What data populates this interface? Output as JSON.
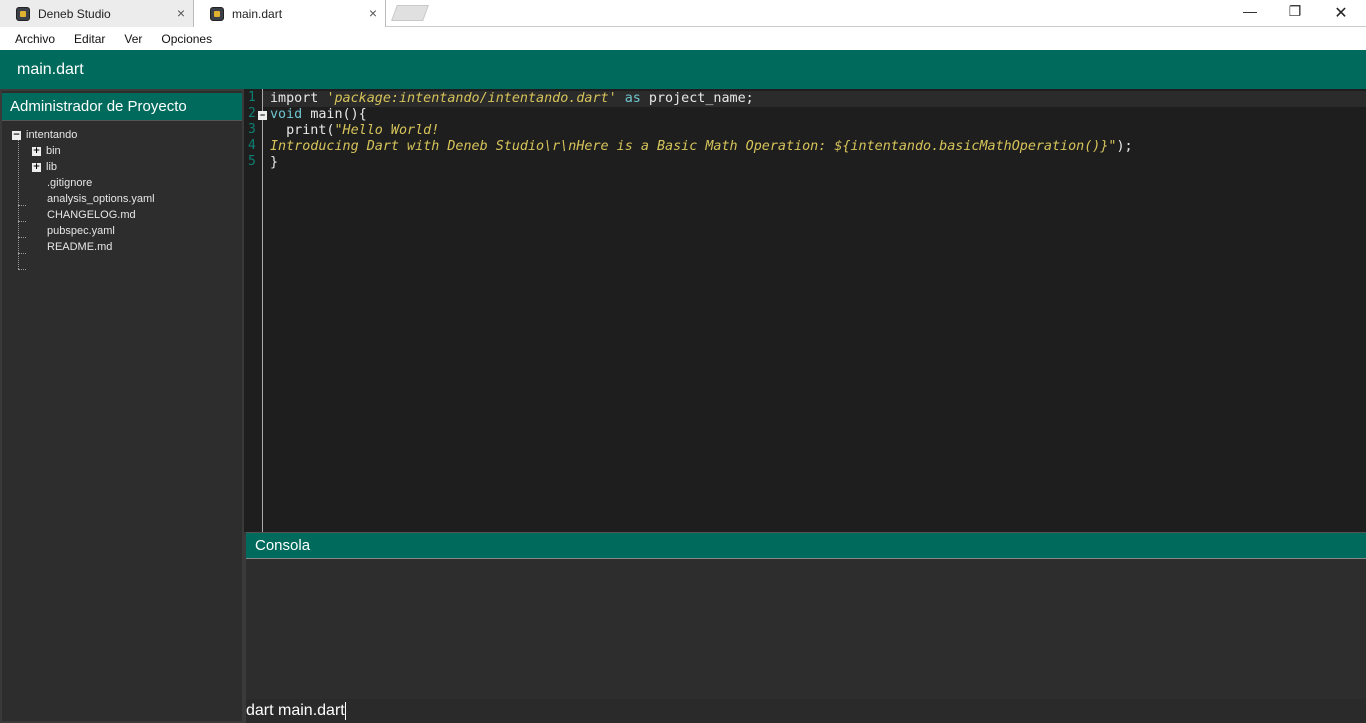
{
  "tabs": [
    {
      "label": "Deneb Studio",
      "close": "×"
    },
    {
      "label": "main.dart",
      "close": "×"
    }
  ],
  "window_controls": {
    "minimize": "—",
    "maximize": "❐",
    "close": "✕"
  },
  "menu": [
    "Archivo",
    "Editar",
    "Ver",
    "Opciones"
  ],
  "header": {
    "title": "main.dart"
  },
  "sidebar": {
    "title": "Administrador de Proyecto",
    "tree": {
      "root": "intentando",
      "folders": [
        "bin",
        "lib"
      ],
      "files": [
        ".gitignore",
        "analysis_options.yaml",
        "CHANGELOG.md",
        "pubspec.yaml",
        "README.md"
      ]
    }
  },
  "editor": {
    "line_numbers": [
      "1",
      "2",
      "3",
      "4",
      "5"
    ],
    "lines": {
      "l1_kw1": "import",
      "l1_str": "'package:intentando/intentando.dart'",
      "l1_kw2": "as",
      "l1_rest": "project_name;",
      "l2_kw": "void",
      "l2_rest": "main(){",
      "l3_a": "  print(",
      "l3_str": "\"Hello World!",
      "l4_str": "Introducing Dart with Deneb Studio\\r\\nHere is a Basic Math Operation: ${intentando.basicMathOperation()}\"",
      "l4_rest": ");",
      "l5": "}"
    }
  },
  "console": {
    "title": "Consola",
    "input_value": "dart main.dart"
  },
  "colors": {
    "accent": "#006b5d",
    "editor_bg": "#1e1e1e",
    "string": "#d6c45a",
    "keyword": "#6ec7d0"
  }
}
